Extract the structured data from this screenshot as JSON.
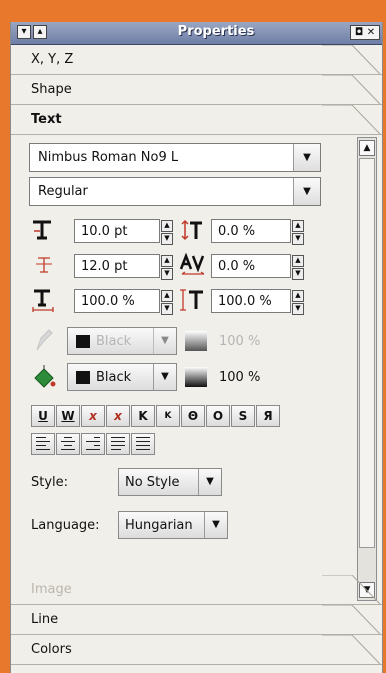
{
  "window": {
    "title": "Properties",
    "left_controls": [
      "▾",
      "▴"
    ],
    "right_controls": "◘ ✕"
  },
  "sections": {
    "xyz": "X, Y, Z",
    "shape": "Shape",
    "text": "Text",
    "image": "Image",
    "line": "Line",
    "colors": "Colors"
  },
  "text": {
    "font_family": "Nimbus Roman No9 L",
    "font_style": "Regular",
    "font_size": "10.0 pt",
    "char_offset": "0.0 %",
    "line_spacing": "12.0 pt",
    "tracking": "0.0 %",
    "scale_h": "100.0 %",
    "scale_v": "100.0 %",
    "stroke_color": "Black",
    "stroke_shade": "100 %",
    "fill_color": "Black",
    "fill_shade": "100 %",
    "format_buttons": [
      "U",
      "W",
      "x",
      "x",
      "K",
      "K",
      "Θ",
      "O",
      "S",
      "Я"
    ],
    "style_label": "Style:",
    "style_value": "No Style",
    "language_label": "Language:",
    "language_value": "Hungarian"
  },
  "colors": {
    "accent": "#e8792c",
    "titlebar": "#7b8ab0",
    "panel": "#f1efe9"
  }
}
